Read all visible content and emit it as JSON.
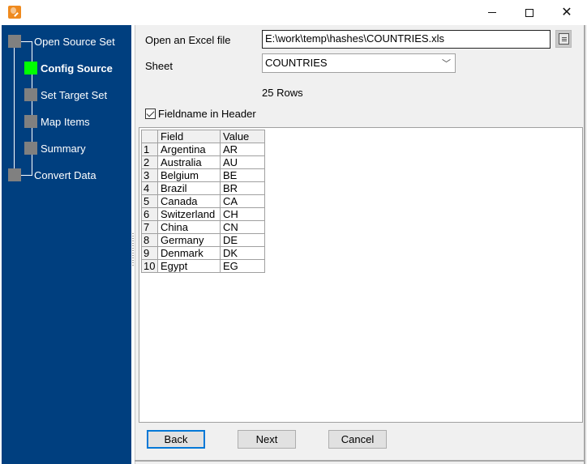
{
  "window": {
    "title": "",
    "icons": {
      "app": "app-icon",
      "minimize": "minimize-icon",
      "maximize": "maximize-icon",
      "close": "close-icon"
    }
  },
  "sidebar": {
    "steps": [
      {
        "label": "Open Source Set",
        "active": false
      },
      {
        "label": "Config Source",
        "active": true
      },
      {
        "label": "Set Target Set",
        "active": false
      },
      {
        "label": "Map Items",
        "active": false
      },
      {
        "label": "Summary",
        "active": false
      },
      {
        "label": "Convert Data",
        "active": false
      }
    ],
    "active_color": "#00ff00",
    "inactive_color": "#808080",
    "background": "#003f7f"
  },
  "form": {
    "file_label": "Open an Excel file",
    "file_value": "E:\\work\\temp\\hashes\\COUNTRIES.xls",
    "sheet_label": "Sheet",
    "sheet_value": "COUNTRIES",
    "rows_count": "25 Rows",
    "header_checkbox_label": "Fieldname in Header",
    "header_checkbox_checked": true
  },
  "grid": {
    "columns": [
      "Field",
      "Value"
    ],
    "rows": [
      {
        "num": "1",
        "field": "Argentina",
        "value": "AR"
      },
      {
        "num": "2",
        "field": "Australia",
        "value": "AU"
      },
      {
        "num": "3",
        "field": "Belgium",
        "value": "BE"
      },
      {
        "num": "4",
        "field": "Brazil",
        "value": "BR"
      },
      {
        "num": "5",
        "field": "Canada",
        "value": "CA"
      },
      {
        "num": "6",
        "field": "Switzerland",
        "value": "CH"
      },
      {
        "num": "7",
        "field": "China",
        "value": "CN"
      },
      {
        "num": "8",
        "field": "Germany",
        "value": "DE"
      },
      {
        "num": "9",
        "field": "Denmark",
        "value": "DK"
      },
      {
        "num": "10",
        "field": "Egypt",
        "value": "EG"
      }
    ]
  },
  "buttons": {
    "back": "Back",
    "next": "Next",
    "cancel": "Cancel"
  }
}
